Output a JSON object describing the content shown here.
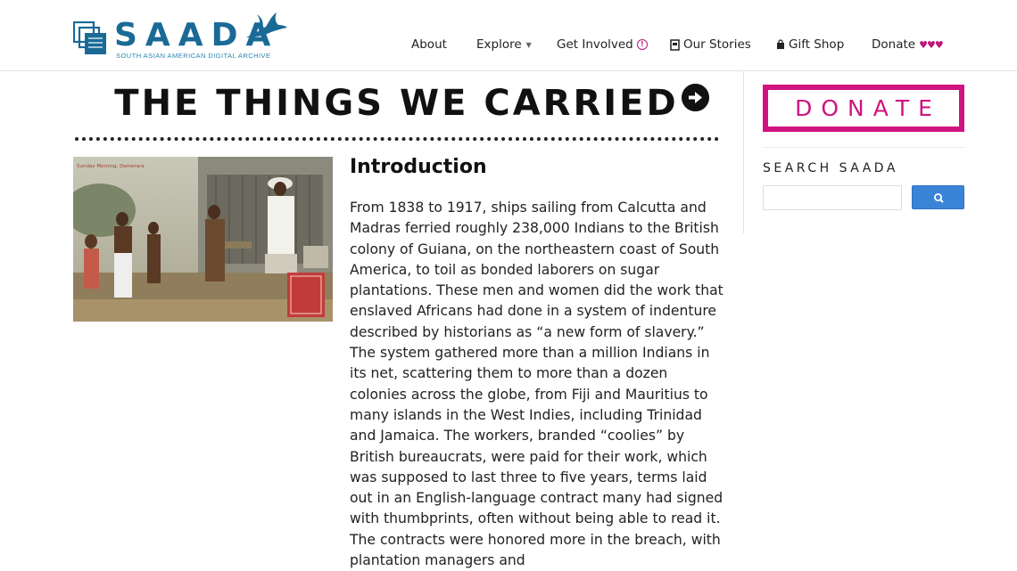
{
  "header": {
    "logo": {
      "wordmark": "SAADA",
      "tagline": "SOUTH ASIAN AMERICAN DIGITAL ARCHIVE",
      "color": "#1a6a96"
    },
    "nav": {
      "about": "About",
      "explore": "Explore",
      "get_involved": "Get Involved",
      "our_stories": "Our Stories",
      "gift_shop": "Gift Shop",
      "donate": "Donate",
      "donate_hearts": "♥♥♥"
    }
  },
  "main": {
    "title": "THE THINGS WE CARRIED",
    "next_icon": "arrow-right-circle-icon",
    "image_caption": "Sunday Morning, Demerara",
    "section_heading": "Introduction",
    "body": "From 1838 to 1917, ships sailing from Calcutta and Madras ferried roughly 238,000 Indians to the British colony of Guiana, on the northeastern coast of South America, to toil as bonded laborers on sugar plantations. These men and women did the work that enslaved Africans had done in a system of indenture described by historians as “a new form of slavery.” The system gathered more than a million Indians in its net, scattering them to more than a dozen colonies across the globe, from Fiji and Mauritius to many islands in the West Indies, including Trinidad and Jamaica. The workers, branded “coolies” by British bureaucrats, were paid for their work, which was supposed to last three to five years, terms laid out in an English-language contract many had signed with thumbprints, often without being able to read it. The contracts were honored more in the breach, with plantation managers and"
  },
  "sidebar": {
    "donate_label": "DONATE",
    "search_label": "SEARCH SAADA",
    "search_placeholder": "",
    "accent": "#d0147f",
    "search_button_color": "#3a84d8"
  }
}
